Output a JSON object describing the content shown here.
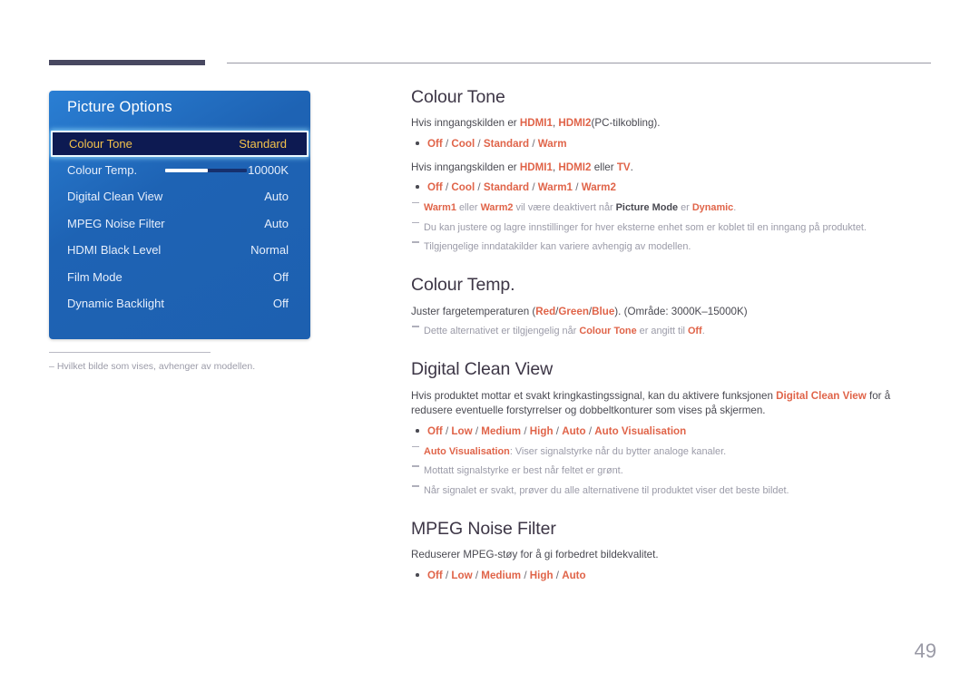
{
  "page": {
    "number": "49"
  },
  "osd": {
    "title": "Picture Options",
    "rows": [
      {
        "label": "Colour Tone",
        "value": "Standard",
        "selected": true,
        "slider": false
      },
      {
        "label": "Colour Temp.",
        "value": "10000K",
        "selected": false,
        "slider": true
      },
      {
        "label": "Digital Clean View",
        "value": "Auto",
        "selected": false,
        "slider": false
      },
      {
        "label": "MPEG Noise Filter",
        "value": "Auto",
        "selected": false,
        "slider": false
      },
      {
        "label": "HDMI Black Level",
        "value": "Normal",
        "selected": false,
        "slider": false
      },
      {
        "label": "Film Mode",
        "value": "Off",
        "selected": false,
        "slider": false
      },
      {
        "label": "Dynamic Backlight",
        "value": "Off",
        "selected": false,
        "slider": false
      }
    ],
    "footnote": "Hvilket bilde som vises, avhenger av modellen.",
    "footnote_dash": "‒"
  },
  "sections": {
    "colour_tone": {
      "title": "Colour Tone",
      "line1_a": "Hvis inngangskilden er ",
      "line1_hl1": "HDMI1",
      "line1_b": ", ",
      "line1_hl2": "HDMI2",
      "line1_c": "(PC-tilkobling).",
      "bullet1": [
        "Off",
        "Cool",
        "Standard",
        "Warm"
      ],
      "line2_a": "Hvis inngangskilden er ",
      "line2_hl1": "HDMI1",
      "line2_b": ", ",
      "line2_hl2": "HDMI2",
      "line2_c": " eller ",
      "line2_hl3": "TV",
      "line2_d": ".",
      "bullet2": [
        "Off",
        "Cool",
        "Standard",
        "Warm1",
        "Warm2"
      ],
      "note1_a": "Warm1",
      "note1_b": " eller ",
      "note1_c": "Warm2",
      "note1_d": " vil være deaktivert når ",
      "note1_e": "Picture Mode",
      "note1_f": " er ",
      "note1_g": "Dynamic",
      "note1_h": ".",
      "note2": "Du kan justere og lagre innstillinger for hver eksterne enhet som er koblet til en inngang på produktet.",
      "note3": "Tilgjengelige inndatakilder kan variere avhengig av modellen."
    },
    "colour_temp": {
      "title": "Colour Temp.",
      "line1_a": "Juster fargetemperaturen (",
      "line1_hl1": "Red",
      "line1_s1": "/",
      "line1_hl2": "Green",
      "line1_s2": "/",
      "line1_hl3": "Blue",
      "line1_b": "). (Område: 3000K–15000K)",
      "note1_a": "Dette alternativet er tilgjengelig når ",
      "note1_hl1": "Colour Tone",
      "note1_b": " er angitt til ",
      "note1_hl2": "Off",
      "note1_c": "."
    },
    "digital_clean_view": {
      "title": "Digital Clean View",
      "line1_a": "Hvis produktet mottar et svakt kringkastingssignal, kan du aktivere funksjonen ",
      "line1_hl1": "Digital Clean View",
      "line1_b": " for å redusere eventuelle forstyrrelser og dobbeltkonturer som vises på skjermen.",
      "bullet1": [
        "Off",
        "Low",
        "Medium",
        "High",
        "Auto",
        "Auto Visualisation"
      ],
      "note1_hl": "Auto Visualisation",
      "note1_text": ": Viser signalstyrke når du bytter analoge kanaler.",
      "note2": "Mottatt signalstyrke er best når feltet er grønt.",
      "note3": "Når signalet er svakt, prøver du alle alternativene til produktet viser det beste bildet."
    },
    "mpeg_noise_filter": {
      "title": "MPEG Noise Filter",
      "line1": "Reduserer MPEG-støy for å gi forbedret bildekvalitet.",
      "bullet1": [
        "Off",
        "Low",
        "Medium",
        "High",
        "Auto"
      ]
    }
  },
  "colors": {
    "accent_orange": "#e06449",
    "osd_blue": "#1e63b4",
    "osd_selected_bg": "#0d1a52",
    "osd_selected_text": "#f2c14b",
    "heading": "#3d3646",
    "note_gray": "#9b9ba8",
    "rule_dark": "#484861"
  }
}
